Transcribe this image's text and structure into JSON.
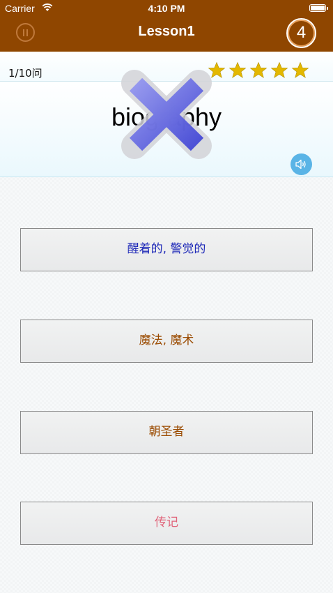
{
  "status_bar": {
    "carrier": "Carrier",
    "time": "4:10 PM"
  },
  "nav": {
    "title": "Lesson1",
    "remaining_count": "4"
  },
  "progress": {
    "question_counter": "1/10问",
    "stars_rating": 5,
    "stars_max": 5
  },
  "question": {
    "word": "biography",
    "result_icon": "wrong-x-icon"
  },
  "answers": [
    {
      "label": "醒着的, 警觉的",
      "color": "#1f2ab8"
    },
    {
      "label": "魔法, 魔术",
      "color": "#9a4a00"
    },
    {
      "label": "朝圣者",
      "color": "#9a4a00"
    },
    {
      "label": "传记",
      "color": "#e0647a"
    }
  ],
  "colors": {
    "nav_background": "#8f4600",
    "star": "#e3b800",
    "speaker": "#5ab4e6",
    "wrong_mark": "#5b5fe0"
  }
}
